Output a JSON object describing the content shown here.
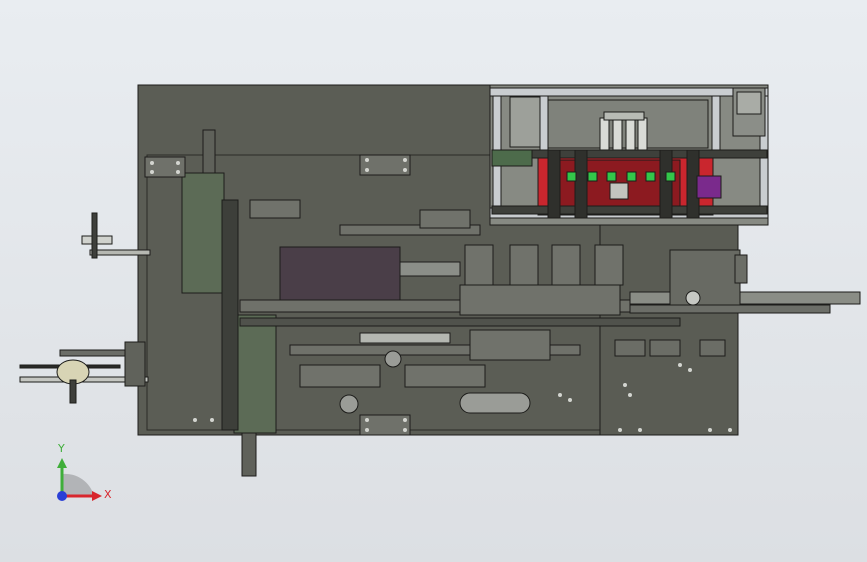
{
  "viewport": {
    "background_top": "#e9edf1",
    "background_bottom": "#dcdfe3"
  },
  "triad": {
    "x_label": "X",
    "y_label": "Y",
    "x_color": "#d8262d",
    "y_color": "#3fae3a",
    "z_color": "#2a3fd6"
  },
  "colors": {
    "plate": "#5b5d55",
    "plate_dark": "#43453f",
    "edge": "#1c1c1a",
    "frame": "#c9cdd0",
    "red_part": "#c9262e",
    "green_part": "#33c64a",
    "purple_part": "#7a2a8c",
    "dark_block": "#4a3e48"
  }
}
